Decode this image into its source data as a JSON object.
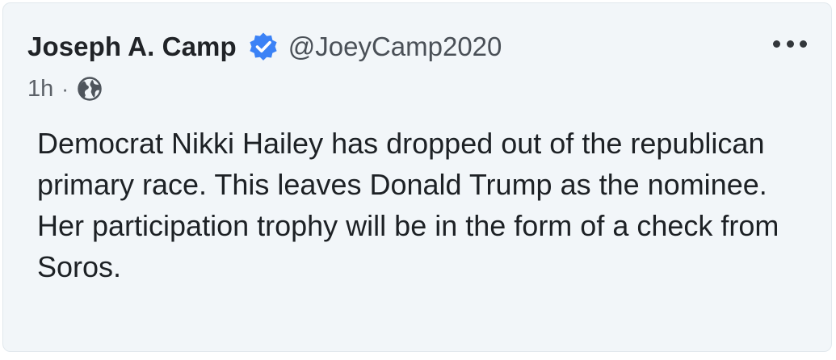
{
  "post": {
    "author_name": "Joseph A. Camp",
    "handle": "@JoeyCamp2020",
    "verified": true,
    "time": "1h",
    "separator": "·",
    "visibility_icon": "globe-icon",
    "more_icon": "more-options-icon",
    "body_lines": [
      "Democrat Nikki Hailey has dropped out of the republican primary race. This leaves Donald Trump as the nominee.",
      "Her participation trophy will be in the form of a check from Soros."
    ]
  },
  "colors": {
    "card_background": "#f2f6f9",
    "verified_badge": "#3b82f6",
    "text": "#1d2125",
    "muted": "#5c6168"
  }
}
